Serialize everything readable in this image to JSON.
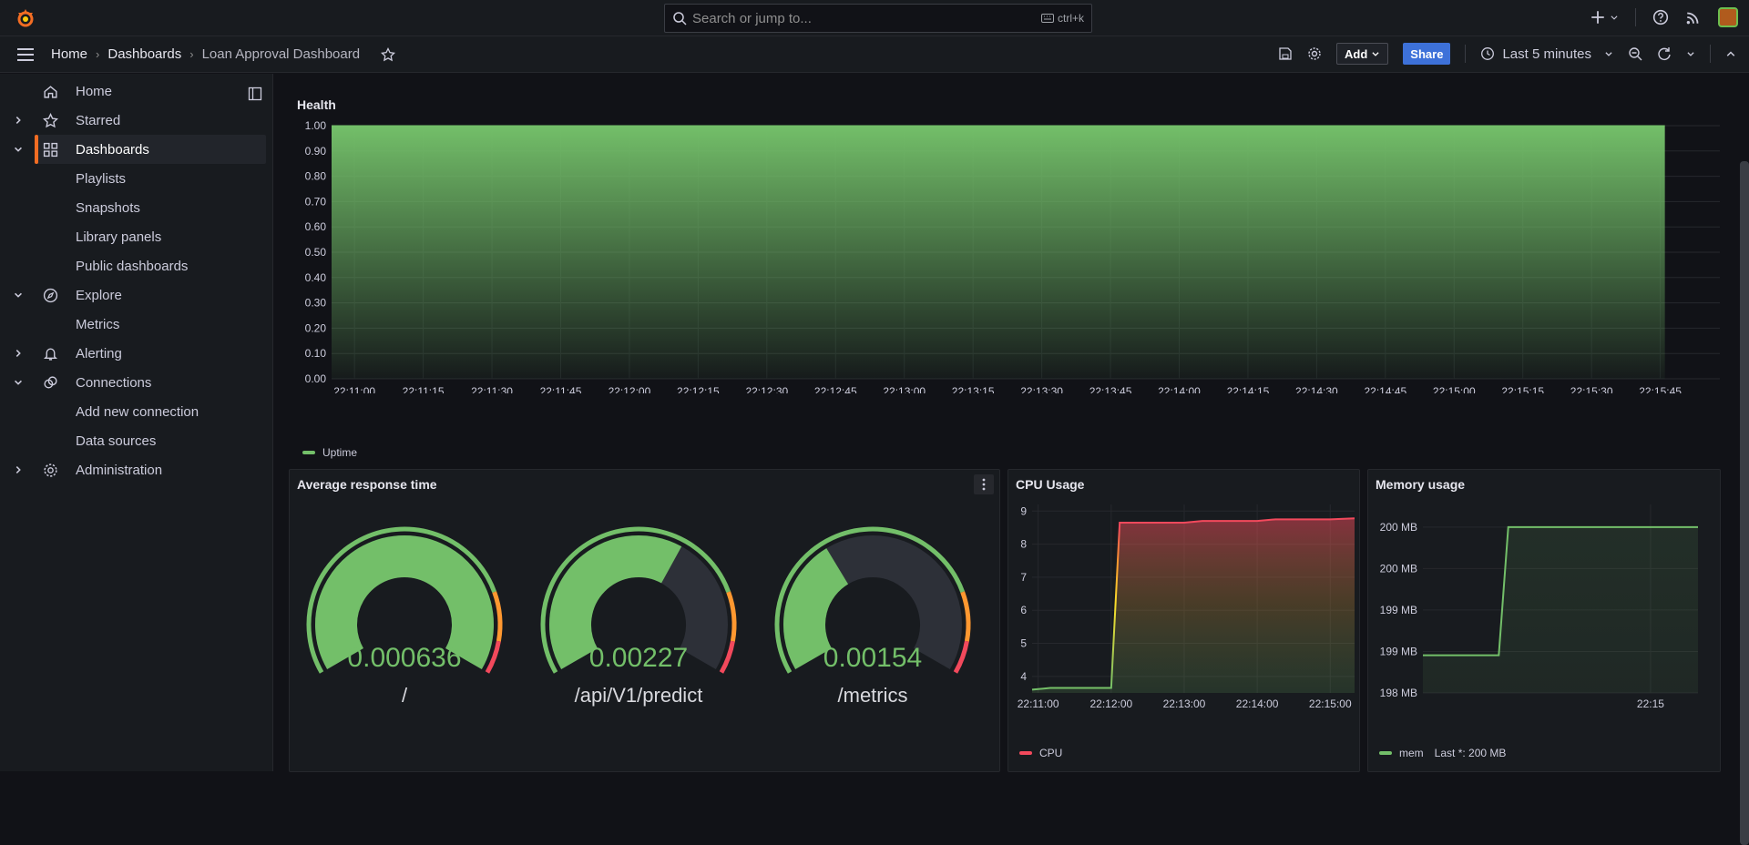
{
  "topbar": {
    "search_placeholder": "Search or jump to...",
    "search_shortcut": "ctrl+k",
    "icons": [
      "grafana-logo-icon",
      "plus-icon",
      "help-icon",
      "news-rss-icon",
      "user-avatar"
    ]
  },
  "navbar": {
    "breadcrumbs": [
      "Home",
      "Dashboards",
      "Loan Approval Dashboard"
    ],
    "add_label": "Add",
    "share_label": "Share",
    "time_range": "Last 5 minutes"
  },
  "sidebar": {
    "items": [
      {
        "label": "Home",
        "icon": "home-icon"
      },
      {
        "label": "Starred",
        "icon": "star-icon",
        "expand": "collapsed"
      },
      {
        "label": "Dashboards",
        "icon": "apps-grid-icon",
        "expand": "expanded",
        "active": true
      },
      {
        "label": "Playlists",
        "sub": true
      },
      {
        "label": "Snapshots",
        "sub": true
      },
      {
        "label": "Library panels",
        "sub": true
      },
      {
        "label": "Public dashboards",
        "sub": true
      },
      {
        "label": "Explore",
        "icon": "compass-icon",
        "expand": "expanded"
      },
      {
        "label": "Metrics",
        "sub": true
      },
      {
        "label": "Alerting",
        "icon": "bell-icon",
        "expand": "collapsed"
      },
      {
        "label": "Connections",
        "icon": "connections-icon",
        "expand": "expanded"
      },
      {
        "label": "Add new connection",
        "sub": true
      },
      {
        "label": "Data sources",
        "sub": true
      },
      {
        "label": "Administration",
        "icon": "gear-icon",
        "expand": "collapsed"
      }
    ]
  },
  "colors": {
    "accent": "#f36d23",
    "green": "#73bf69",
    "red": "#f2495c",
    "orange": "#ff9830",
    "blue": "#3d71d9"
  },
  "panels": {
    "health": {
      "title": "Health",
      "legend": "Uptime",
      "chart_data": {
        "type": "area",
        "yticks": [
          "0.00",
          "0.10",
          "0.20",
          "0.30",
          "0.40",
          "0.50",
          "0.60",
          "0.70",
          "0.80",
          "0.90",
          "1.00"
        ],
        "xticks": [
          "22:11:00",
          "22:11:15",
          "22:11:30",
          "22:11:45",
          "22:12:00",
          "22:12:15",
          "22:12:30",
          "22:12:45",
          "22:13:00",
          "22:13:15",
          "22:13:30",
          "22:13:45",
          "22:14:00",
          "22:14:15",
          "22:14:30",
          "22:14:45",
          "22:15:00",
          "22:15:15",
          "22:15:30",
          "22:15:45"
        ],
        "ylim": [
          0,
          1
        ],
        "series": [
          {
            "name": "Uptime",
            "x_start": "22:10:55",
            "x_end": "22:15:46",
            "value": 1.0
          }
        ]
      }
    },
    "response": {
      "title": "Average response time",
      "gauges": [
        {
          "label": "/",
          "value": "0.000636",
          "fraction": 1.0
        },
        {
          "label": "/api/V1/predict",
          "value": "0.00227",
          "fraction": 0.62
        },
        {
          "label": "/metrics",
          "value": "0.00154",
          "fraction": 0.37
        }
      ]
    },
    "cpu": {
      "title": "CPU Usage",
      "legend": "CPU",
      "chart_data": {
        "type": "line",
        "yticks": [
          "4",
          "5",
          "6",
          "7",
          "8",
          "9"
        ],
        "xticks": [
          "22:11:00",
          "22:12:00",
          "22:13:00",
          "22:14:00",
          "22:15:00"
        ],
        "ylim": [
          3.5,
          9.2
        ],
        "series": [
          {
            "name": "CPU",
            "x": [
              "22:10:55",
              "22:11:10",
              "22:11:30",
              "22:11:50",
              "22:12:00",
              "22:12:07",
              "22:12:30",
              "22:13:00",
              "22:13:15",
              "22:14:00",
              "22:14:15",
              "22:15:00",
              "22:15:20"
            ],
            "values": [
              3.6,
              3.65,
              3.65,
              3.65,
              3.65,
              8.65,
              8.65,
              8.65,
              8.7,
              8.7,
              8.75,
              8.75,
              8.78
            ]
          }
        ]
      }
    },
    "memory": {
      "title": "Memory usage",
      "legend": "mem",
      "legend_last": "Last *: 200 MB",
      "chart_data": {
        "type": "line",
        "yticks": [
          "198 MB",
          "199 MB",
          "199 MB",
          "200 MB",
          "200 MB"
        ],
        "xticks": [
          "22:15"
        ],
        "ylim": [
          198,
          200.5
        ],
        "series": [
          {
            "name": "mem",
            "x": [
              "22:11:00",
              "22:12:20",
              "22:12:30",
              "22:15:50"
            ],
            "values": [
              198.5,
              198.5,
              200.2,
              200.2
            ]
          }
        ]
      }
    }
  }
}
